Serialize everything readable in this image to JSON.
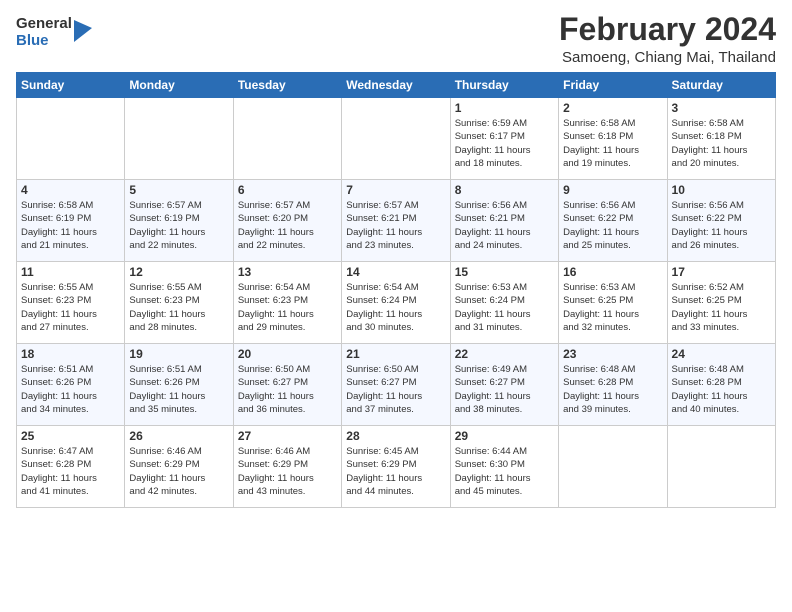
{
  "logo": {
    "general": "General",
    "blue": "Blue"
  },
  "title": {
    "month_year": "February 2024",
    "location": "Samoeng, Chiang Mai, Thailand"
  },
  "days_of_week": [
    "Sunday",
    "Monday",
    "Tuesday",
    "Wednesday",
    "Thursday",
    "Friday",
    "Saturday"
  ],
  "weeks": [
    [
      {
        "day": "",
        "info": ""
      },
      {
        "day": "",
        "info": ""
      },
      {
        "day": "",
        "info": ""
      },
      {
        "day": "",
        "info": ""
      },
      {
        "day": "1",
        "info": "Sunrise: 6:59 AM\nSunset: 6:17 PM\nDaylight: 11 hours\nand 18 minutes."
      },
      {
        "day": "2",
        "info": "Sunrise: 6:58 AM\nSunset: 6:18 PM\nDaylight: 11 hours\nand 19 minutes."
      },
      {
        "day": "3",
        "info": "Sunrise: 6:58 AM\nSunset: 6:18 PM\nDaylight: 11 hours\nand 20 minutes."
      }
    ],
    [
      {
        "day": "4",
        "info": "Sunrise: 6:58 AM\nSunset: 6:19 PM\nDaylight: 11 hours\nand 21 minutes."
      },
      {
        "day": "5",
        "info": "Sunrise: 6:57 AM\nSunset: 6:19 PM\nDaylight: 11 hours\nand 22 minutes."
      },
      {
        "day": "6",
        "info": "Sunrise: 6:57 AM\nSunset: 6:20 PM\nDaylight: 11 hours\nand 22 minutes."
      },
      {
        "day": "7",
        "info": "Sunrise: 6:57 AM\nSunset: 6:21 PM\nDaylight: 11 hours\nand 23 minutes."
      },
      {
        "day": "8",
        "info": "Sunrise: 6:56 AM\nSunset: 6:21 PM\nDaylight: 11 hours\nand 24 minutes."
      },
      {
        "day": "9",
        "info": "Sunrise: 6:56 AM\nSunset: 6:22 PM\nDaylight: 11 hours\nand 25 minutes."
      },
      {
        "day": "10",
        "info": "Sunrise: 6:56 AM\nSunset: 6:22 PM\nDaylight: 11 hours\nand 26 minutes."
      }
    ],
    [
      {
        "day": "11",
        "info": "Sunrise: 6:55 AM\nSunset: 6:23 PM\nDaylight: 11 hours\nand 27 minutes."
      },
      {
        "day": "12",
        "info": "Sunrise: 6:55 AM\nSunset: 6:23 PM\nDaylight: 11 hours\nand 28 minutes."
      },
      {
        "day": "13",
        "info": "Sunrise: 6:54 AM\nSunset: 6:23 PM\nDaylight: 11 hours\nand 29 minutes."
      },
      {
        "day": "14",
        "info": "Sunrise: 6:54 AM\nSunset: 6:24 PM\nDaylight: 11 hours\nand 30 minutes."
      },
      {
        "day": "15",
        "info": "Sunrise: 6:53 AM\nSunset: 6:24 PM\nDaylight: 11 hours\nand 31 minutes."
      },
      {
        "day": "16",
        "info": "Sunrise: 6:53 AM\nSunset: 6:25 PM\nDaylight: 11 hours\nand 32 minutes."
      },
      {
        "day": "17",
        "info": "Sunrise: 6:52 AM\nSunset: 6:25 PM\nDaylight: 11 hours\nand 33 minutes."
      }
    ],
    [
      {
        "day": "18",
        "info": "Sunrise: 6:51 AM\nSunset: 6:26 PM\nDaylight: 11 hours\nand 34 minutes."
      },
      {
        "day": "19",
        "info": "Sunrise: 6:51 AM\nSunset: 6:26 PM\nDaylight: 11 hours\nand 35 minutes."
      },
      {
        "day": "20",
        "info": "Sunrise: 6:50 AM\nSunset: 6:27 PM\nDaylight: 11 hours\nand 36 minutes."
      },
      {
        "day": "21",
        "info": "Sunrise: 6:50 AM\nSunset: 6:27 PM\nDaylight: 11 hours\nand 37 minutes."
      },
      {
        "day": "22",
        "info": "Sunrise: 6:49 AM\nSunset: 6:27 PM\nDaylight: 11 hours\nand 38 minutes."
      },
      {
        "day": "23",
        "info": "Sunrise: 6:48 AM\nSunset: 6:28 PM\nDaylight: 11 hours\nand 39 minutes."
      },
      {
        "day": "24",
        "info": "Sunrise: 6:48 AM\nSunset: 6:28 PM\nDaylight: 11 hours\nand 40 minutes."
      }
    ],
    [
      {
        "day": "25",
        "info": "Sunrise: 6:47 AM\nSunset: 6:28 PM\nDaylight: 11 hours\nand 41 minutes."
      },
      {
        "day": "26",
        "info": "Sunrise: 6:46 AM\nSunset: 6:29 PM\nDaylight: 11 hours\nand 42 minutes."
      },
      {
        "day": "27",
        "info": "Sunrise: 6:46 AM\nSunset: 6:29 PM\nDaylight: 11 hours\nand 43 minutes."
      },
      {
        "day": "28",
        "info": "Sunrise: 6:45 AM\nSunset: 6:29 PM\nDaylight: 11 hours\nand 44 minutes."
      },
      {
        "day": "29",
        "info": "Sunrise: 6:44 AM\nSunset: 6:30 PM\nDaylight: 11 hours\nand 45 minutes."
      },
      {
        "day": "",
        "info": ""
      },
      {
        "day": "",
        "info": ""
      }
    ]
  ]
}
